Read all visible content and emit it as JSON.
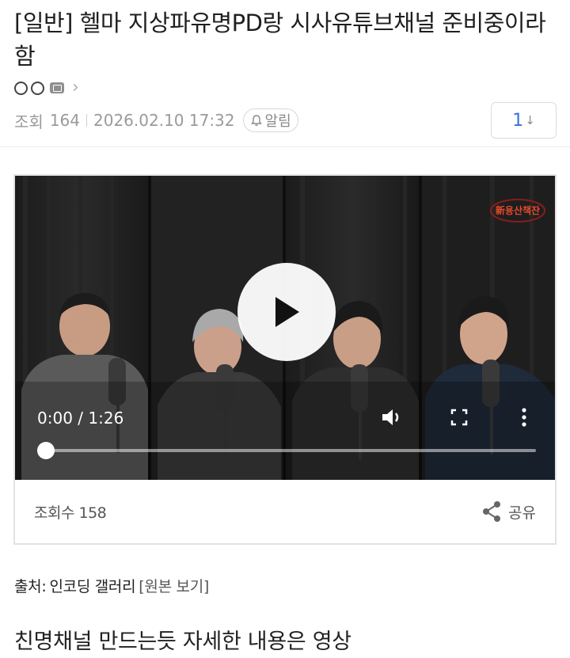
{
  "post": {
    "title": "[일반] 헬마 지상파유명PD랑 시사유튜브채널 준비중이라함",
    "views_label": "조회",
    "views_count": "164",
    "datetime": "2026.02.10 17:32",
    "alarm_label": "알림",
    "page_number": "1",
    "page_arrow": "↓"
  },
  "video": {
    "time_current": "0:00",
    "time_separator": "/",
    "time_total": "1:26",
    "progress_fraction": 0,
    "logo_text": "新용산책잔",
    "views_label": "조회수",
    "views_count": "158",
    "share_label": "공유"
  },
  "source": {
    "prefix": "출처:",
    "gallery": "인코딩 갤러리",
    "link": "[원본 보기]"
  },
  "body": {
    "text": "친명채널 만드는듯 자세한 내용은 영상"
  },
  "icons": [
    "user-level-circle-icon",
    "user-level-circle-icon",
    "member-badge-icon",
    "chevron-right-icon",
    "bell-icon",
    "play-icon",
    "volume-icon",
    "fullscreen-icon",
    "more-vertical-icon",
    "share-icon"
  ],
  "colors": {
    "accent": "#3a6fd8",
    "muted": "#9a9a9a",
    "video_bg": "#151515"
  }
}
